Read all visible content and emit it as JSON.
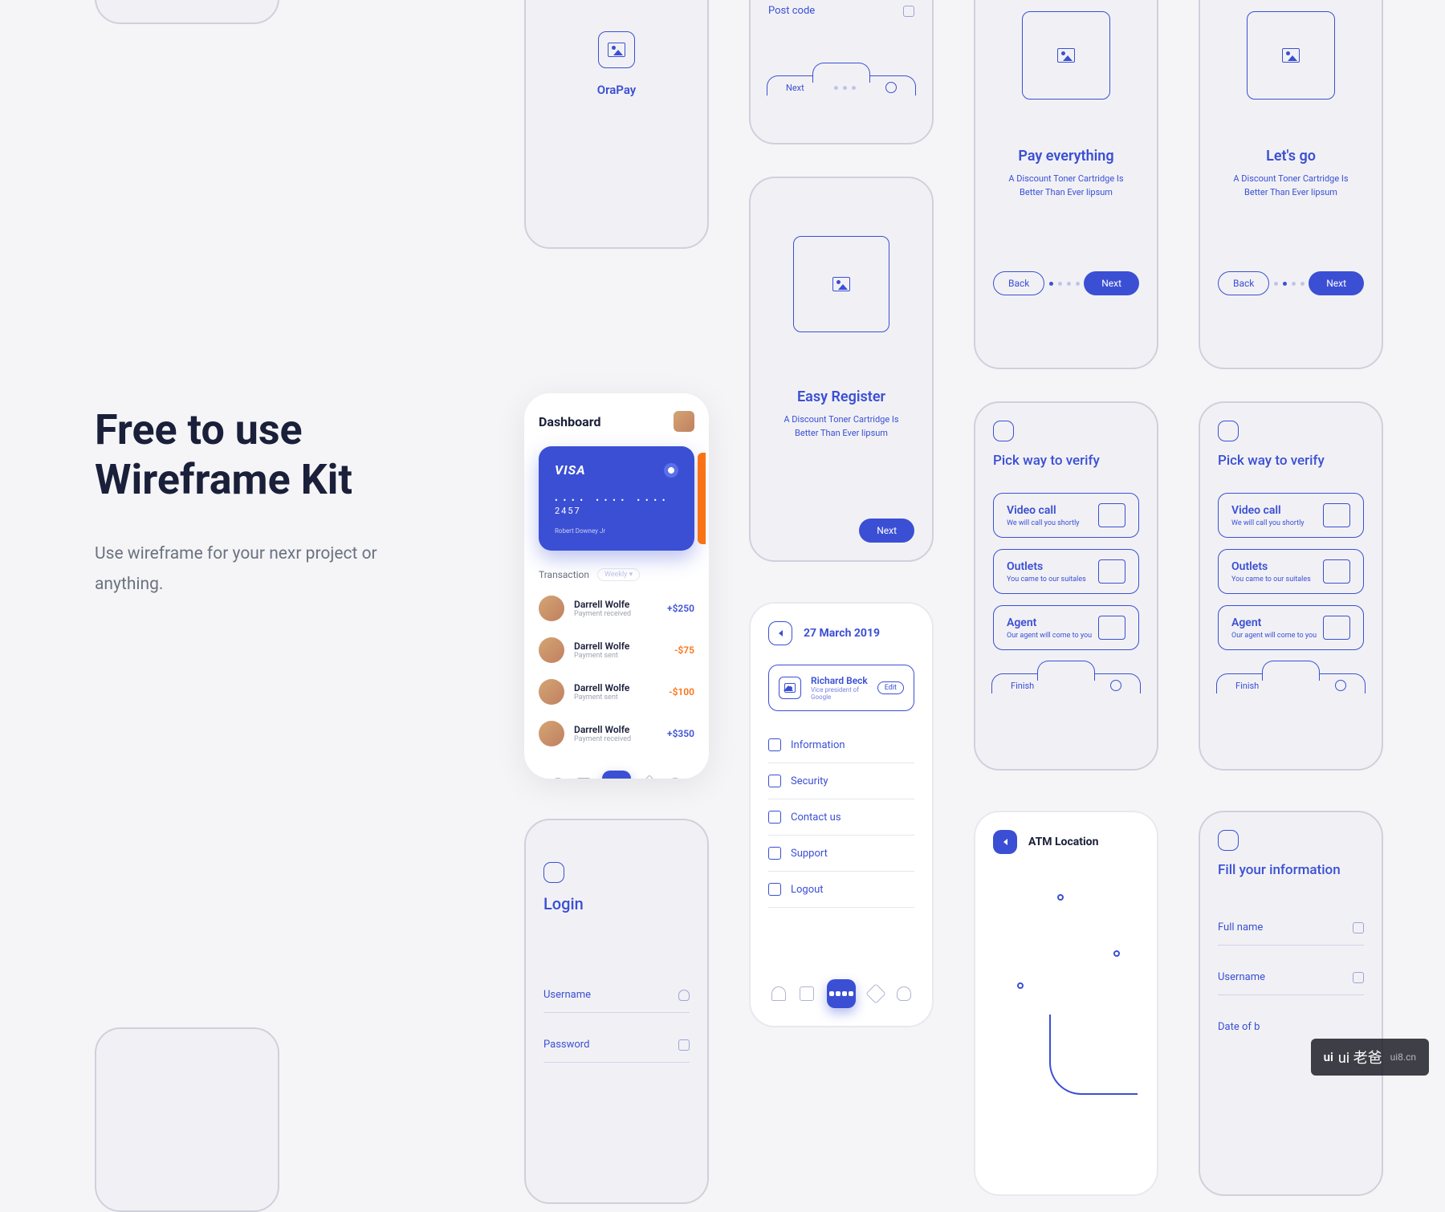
{
  "hero": {
    "title_l1": "Free to use",
    "title_l2": "Wireframe Kit",
    "sub": "Use wireframe for your nexr project or anything."
  },
  "splash": {
    "brand": "OraPay"
  },
  "postcode": {
    "label": "Post code",
    "next": "Next"
  },
  "onboard": [
    {
      "title": "Pay everything",
      "sub": "A Discount Toner Cartridge Is Better Than Ever lipsum",
      "back": "Back",
      "next": "Next"
    },
    {
      "title": "Let's go",
      "sub": "A Discount Toner Cartridge Is Better Than Ever lipsum",
      "back": "Back",
      "next": "Next"
    }
  ],
  "register": {
    "title": "Easy Register",
    "sub": "A Discount Toner Cartridge Is Better Than Ever lipsum",
    "next": "Next"
  },
  "dashboard": {
    "title": "Dashboard",
    "card": {
      "brand": "VISA",
      "last4": "2457",
      "holder": "Robert Downey Jr"
    },
    "section": "Transaction",
    "filter": "Weekly",
    "txns": [
      {
        "name": "Darrell Wolfe",
        "desc": "Payment received",
        "amt": "+$250",
        "cls": "pos"
      },
      {
        "name": "Darrell Wolfe",
        "desc": "Payment sent",
        "amt": "-$75",
        "cls": "neg"
      },
      {
        "name": "Darrell Wolfe",
        "desc": "Payment sent",
        "amt": "-$100",
        "cls": "neg"
      },
      {
        "name": "Darrell Wolfe",
        "desc": "Payment received",
        "amt": "+$350",
        "cls": "pos"
      }
    ]
  },
  "login": {
    "title": "Login",
    "user": "Username",
    "pass": "Password"
  },
  "profile": {
    "date": "27 March 2019",
    "name": "Richard Beck",
    "role": "Vice president of Google",
    "edit": "Edit",
    "menu": [
      "Information",
      "Security",
      "Contact us",
      "Support",
      "Logout"
    ]
  },
  "verify": {
    "title": "Pick way to verify",
    "finish": "Finish",
    "opts": [
      {
        "t": "Video call",
        "s": "We will call you shortly"
      },
      {
        "t": "Outlets",
        "s": "You came to our suitales"
      },
      {
        "t": "Agent",
        "s": "Our agent will come to you"
      }
    ]
  },
  "atm": {
    "title": "ATM Location"
  },
  "fill": {
    "title": "Fill your information",
    "f1": "Full name",
    "f2": "Username",
    "f3": "Date of b"
  },
  "watermark": {
    "zh": "ui 老爸",
    "url": "ui8.cn"
  }
}
